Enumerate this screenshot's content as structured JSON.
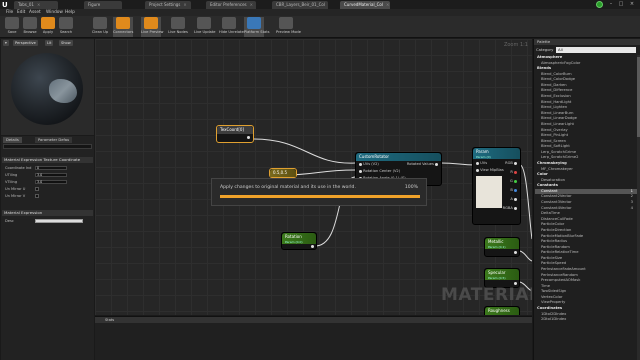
{
  "tabs": [
    {
      "label": "Tabs_01"
    },
    {
      "label": "Figure"
    },
    {
      "label": "Project Settings"
    },
    {
      "label": "Editor Preferences"
    },
    {
      "label": "CBR_Layers_Beir_01_Col"
    },
    {
      "label": "CurvedMaterial_Col"
    }
  ],
  "menu": [
    "File",
    "Edit",
    "Asset",
    "Window",
    "Help"
  ],
  "toolbar": [
    "Save",
    "Browse",
    "Apply",
    "Search",
    "Clean Up",
    "Connectors",
    "Live Preview",
    "Live Nodes",
    "Live Update",
    "Hide Unrelated",
    "Platform Stats",
    "Preview Mode"
  ],
  "viewport": {
    "perspective": "Perspective",
    "lit": "Lit",
    "show": "Show"
  },
  "details": {
    "tab_details": "Details",
    "tab_params": "Parameter Defau",
    "section1": "Material Expression Texture Coordinate",
    "rows": [
      {
        "label": "Coordinate Ind",
        "value": "0"
      },
      {
        "label": "UTiling",
        "value": "3.0"
      },
      {
        "label": "VTiling",
        "value": "3.0"
      },
      {
        "label": "Un Mirror U",
        "value": ""
      },
      {
        "label": "Un Mirror V",
        "value": ""
      }
    ],
    "section2": "Material Expression",
    "desc_label": "Desc"
  },
  "graph": {
    "zoom": "Zoom 1:1",
    "watermark": "MATERIAL",
    "nodes": {
      "texcoord": {
        "title": "TexCoord[0]"
      },
      "const": {
        "title": "0.5,0.5"
      },
      "custom_rotator": {
        "title": "CustomRotator",
        "in1": "UVs (V2)",
        "in2": "Rotation Center (V2)",
        "in3": "Rotation Angle (0-1) (S)",
        "out": "Rotated Values"
      },
      "param": {
        "title": "Param",
        "sub": "Param (0)",
        "out1": "RGB",
        "out2": "R",
        "out3": "G",
        "out4": "B",
        "out5": "A",
        "out6": "RGBA",
        "in": "UVs",
        "in2": "View MipBias"
      },
      "rotation": {
        "title": "Rotation",
        "sub": "Param (0.0)"
      },
      "metallic": {
        "title": "Metallic",
        "sub": "Param (0.1)"
      },
      "specular": {
        "title": "Specular",
        "sub": "Param (0.5)"
      },
      "roughness": {
        "title": "Roughness"
      }
    }
  },
  "popup": {
    "message": "Apply changes to original material and its use in the world.",
    "percent": "100%",
    "progress": 1.0
  },
  "stats": {
    "title": "Stats"
  },
  "palette": {
    "title": "Palette",
    "category_label": "Category",
    "category_value": "All",
    "items": [
      {
        "label": "Atmosphere",
        "header": true
      },
      {
        "label": "AtmosphericFogColor"
      },
      {
        "label": "Blends",
        "header": true
      },
      {
        "label": "Blend_ColorBurn"
      },
      {
        "label": "Blend_ColorDodge"
      },
      {
        "label": "Blend_Darken"
      },
      {
        "label": "Blend_Difference"
      },
      {
        "label": "Blend_Exclusion"
      },
      {
        "label": "Blend_HardLight"
      },
      {
        "label": "Blend_Lighten"
      },
      {
        "label": "Blend_LinearBurn"
      },
      {
        "label": "Blend_LinearDodge"
      },
      {
        "label": "Blend_LinearLight"
      },
      {
        "label": "Blend_Overlay"
      },
      {
        "label": "Blend_PinLight"
      },
      {
        "label": "Blend_Screen"
      },
      {
        "label": "Blend_SoftLight"
      },
      {
        "label": "Lerp_ScratchGrime"
      },
      {
        "label": "Lerp_ScratchGrime2"
      },
      {
        "label": "Chromakeying",
        "header": true
      },
      {
        "label": "MF_Chromakeyer"
      },
      {
        "label": "Color",
        "header": true
      },
      {
        "label": "Desaturation"
      },
      {
        "label": "Constants",
        "header": true
      },
      {
        "label": "Constant",
        "key": "1",
        "selected": true
      },
      {
        "label": "Constant2Vector",
        "key": "2"
      },
      {
        "label": "Constant3Vector",
        "key": "3"
      },
      {
        "label": "Constant4Vector",
        "key": "4"
      },
      {
        "label": "DeltaTime"
      },
      {
        "label": "DistanceCullFade"
      },
      {
        "label": "ParticleColor"
      },
      {
        "label": "ParticleDirection"
      },
      {
        "label": "ParticleMotionBlurFade"
      },
      {
        "label": "ParticleRadius"
      },
      {
        "label": "ParticleRandom"
      },
      {
        "label": "ParticleRelativeTime"
      },
      {
        "label": "ParticleSize"
      },
      {
        "label": "ParticleSpeed"
      },
      {
        "label": "PerInstanceFadeAmount"
      },
      {
        "label": "PerInstanceRandom"
      },
      {
        "label": "PrecomputedAOMask"
      },
      {
        "label": "Time"
      },
      {
        "label": "TwoSidedSign"
      },
      {
        "label": "VertexColor"
      },
      {
        "label": "ViewProperty"
      },
      {
        "label": "Coordinates",
        "header": true
      },
      {
        "label": "1DtoI2DIndex"
      },
      {
        "label": "2DtoI1DIndex"
      }
    ]
  },
  "colors": {
    "accent": "#e08a1c",
    "progress": "#f0a22a",
    "node_teal": "#1e6b80",
    "node_green": "#3c7a1c"
  }
}
